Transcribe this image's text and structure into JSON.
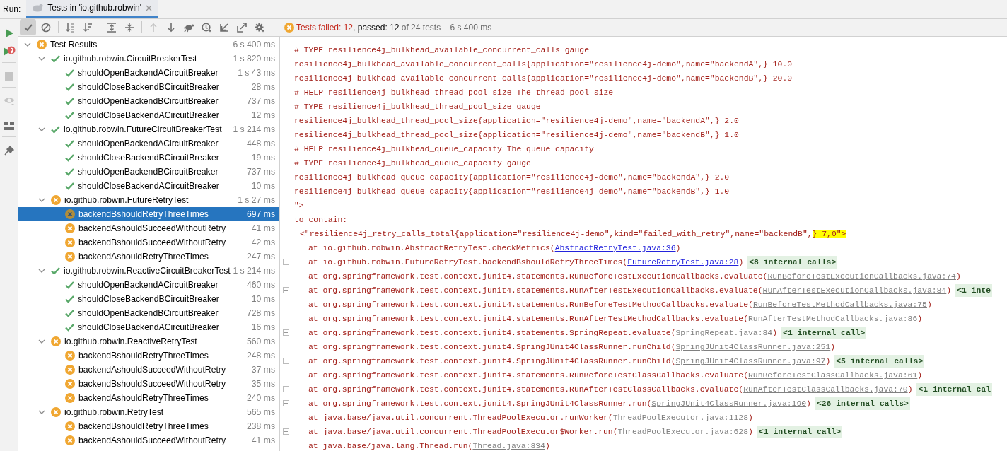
{
  "run_label": "Run:",
  "tabs": [
    {
      "label": "Tests in 'io.github.robwin'",
      "selected": true
    }
  ],
  "toolbar": {
    "toggles": [
      {
        "on": true
      },
      {
        "on": false
      }
    ],
    "navigation": [
      {
        "disabled": true
      },
      {
        "disabled": false
      }
    ]
  },
  "side_toolbar": {
    "stop_disabled": true
  },
  "status": {
    "failed": "Tests failed: 12",
    "passed": ", passed: 12",
    "total": " of 24 tests – 6 s 400 ms"
  },
  "tree": {
    "label": "Test Results",
    "failed": true,
    "time": "6 s 400 ms",
    "expanded": true,
    "children": [
      {
        "label": "io.github.robwin.CircuitBreakerTest",
        "failed": false,
        "time": "1 s 820 ms",
        "expanded": true,
        "children": [
          {
            "label": "shouldOpenBackendACircuitBreaker",
            "failed": false,
            "time": "1 s 43 ms",
            "selected": false
          },
          {
            "label": "shouldCloseBackendBCircuitBreaker",
            "failed": false,
            "time": "28 ms",
            "selected": false
          },
          {
            "label": "shouldOpenBackendBCircuitBreaker",
            "failed": false,
            "time": "737 ms",
            "selected": false
          },
          {
            "label": "shouldCloseBackendACircuitBreaker",
            "failed": false,
            "time": "12 ms",
            "selected": false
          }
        ]
      },
      {
        "label": "io.github.robwin.FutureCircuitBreakerTest",
        "failed": false,
        "time": "1 s 214 ms",
        "expanded": true,
        "children": [
          {
            "label": "shouldOpenBackendACircuitBreaker",
            "failed": false,
            "time": "448 ms",
            "selected": false
          },
          {
            "label": "shouldCloseBackendBCircuitBreaker",
            "failed": false,
            "time": "19 ms",
            "selected": false
          },
          {
            "label": "shouldOpenBackendBCircuitBreaker",
            "failed": false,
            "time": "737 ms",
            "selected": false
          },
          {
            "label": "shouldCloseBackendACircuitBreaker",
            "failed": false,
            "time": "10 ms",
            "selected": false
          }
        ]
      },
      {
        "label": "io.github.robwin.FutureRetryTest",
        "failed": true,
        "time": "1 s 27 ms",
        "expanded": true,
        "children": [
          {
            "label": "backendBshouldRetryThreeTimes",
            "failed": true,
            "time": "697 ms",
            "selected": true
          },
          {
            "label": "backendAshouldSucceedWithoutRetry",
            "failed": true,
            "time": "41 ms",
            "selected": false
          },
          {
            "label": "backendBshouldSucceedWithoutRetry",
            "failed": true,
            "time": "42 ms",
            "selected": false
          },
          {
            "label": "backendAshouldRetryThreeTimes",
            "failed": true,
            "time": "247 ms",
            "selected": false
          }
        ]
      },
      {
        "label": "io.github.robwin.ReactiveCircuitBreakerTest",
        "failed": false,
        "time": "1 s 214 ms",
        "expanded": true,
        "children": [
          {
            "label": "shouldOpenBackendACircuitBreaker",
            "failed": false,
            "time": "460 ms",
            "selected": false
          },
          {
            "label": "shouldCloseBackendBCircuitBreaker",
            "failed": false,
            "time": "10 ms",
            "selected": false
          },
          {
            "label": "shouldOpenBackendBCircuitBreaker",
            "failed": false,
            "time": "728 ms",
            "selected": false
          },
          {
            "label": "shouldCloseBackendACircuitBreaker",
            "failed": false,
            "time": "16 ms",
            "selected": false
          }
        ]
      },
      {
        "label": "io.github.robwin.ReactiveRetryTest",
        "failed": true,
        "time": "560 ms",
        "expanded": true,
        "children": [
          {
            "label": "backendBshouldRetryThreeTimes",
            "failed": true,
            "time": "248 ms",
            "selected": false
          },
          {
            "label": "backendAshouldSucceedWithoutRetry",
            "failed": true,
            "time": "37 ms",
            "selected": false
          },
          {
            "label": "backendBshouldSucceedWithoutRetry",
            "failed": true,
            "time": "35 ms",
            "selected": false
          },
          {
            "label": "backendAshouldRetryThreeTimes",
            "failed": true,
            "time": "240 ms",
            "selected": false
          }
        ]
      },
      {
        "label": "io.github.robwin.RetryTest",
        "failed": true,
        "time": "565 ms",
        "expanded": true,
        "children": [
          {
            "label": "backendBshouldRetryThreeTimes",
            "failed": true,
            "time": "238 ms",
            "selected": false
          },
          {
            "label": "backendAshouldSucceedWithoutRetry",
            "failed": true,
            "time": "41 ms",
            "selected": false
          }
        ]
      }
    ]
  },
  "console": [
    {
      "kind": "text",
      "text": "# TYPE resilience4j_bulkhead_available_concurrent_calls gauge"
    },
    {
      "kind": "text",
      "text": "resilience4j_bulkhead_available_concurrent_calls{application=\"resilience4j-demo\",name=\"backendA\",} 10.0"
    },
    {
      "kind": "text",
      "text": "resilience4j_bulkhead_available_concurrent_calls{application=\"resilience4j-demo\",name=\"backendB\",} 20.0"
    },
    {
      "kind": "text",
      "text": "# HELP resilience4j_bulkhead_thread_pool_size The thread pool size"
    },
    {
      "kind": "text",
      "text": "# TYPE resilience4j_bulkhead_thread_pool_size gauge"
    },
    {
      "kind": "text",
      "text": "resilience4j_bulkhead_thread_pool_size{application=\"resilience4j-demo\",name=\"backendA\",} 2.0"
    },
    {
      "kind": "text",
      "text": "resilience4j_bulkhead_thread_pool_size{application=\"resilience4j-demo\",name=\"backendB\",} 1.0"
    },
    {
      "kind": "text",
      "text": "# HELP resilience4j_bulkhead_queue_capacity The queue capacity"
    },
    {
      "kind": "text",
      "text": "# TYPE resilience4j_bulkhead_queue_capacity gauge"
    },
    {
      "kind": "text",
      "text": "resilience4j_bulkhead_queue_capacity{application=\"resilience4j-demo\",name=\"backendA\",} 2.0"
    },
    {
      "kind": "text",
      "text": "resilience4j_bulkhead_queue_capacity{application=\"resilience4j-demo\",name=\"backendB\",} 1.0"
    },
    {
      "kind": "text",
      "text": "\">"
    },
    {
      "kind": "text",
      "text": "to contain:"
    },
    {
      "kind": "expected",
      "text": "<\"resilience4j_retry_calls_total{application=\"resilience4j-demo\",kind=\"failed_with_retry\",name=\"backendB\",",
      "highlight": "} 7,0\">"
    },
    {
      "kind": "frame",
      "text": "at io.github.robwin.AbstractRetryTest.checkMetrics(",
      "link": "AbstractRetryTest.java:36",
      "close": ")",
      "own": true,
      "foldable": false
    },
    {
      "kind": "frame",
      "text": "at io.github.robwin.FutureRetryTest.backendBshouldRetryThreeTimes(",
      "link": "FutureRetryTest.java:28",
      "close": ")",
      "own": true,
      "foldable": true,
      "internal": "<8 internal calls>"
    },
    {
      "kind": "frame",
      "text": "at org.springframework.test.context.junit4.statements.RunBeforeTestExecutionCallbacks.evaluate(",
      "link": "RunBeforeTestExecutionCallbacks.java:74",
      "close": ")",
      "own": false,
      "foldable": false
    },
    {
      "kind": "frame",
      "text": "at org.springframework.test.context.junit4.statements.RunAfterTestExecutionCallbacks.evaluate(",
      "link": "RunAfterTestExecutionCallbacks.java:84",
      "close": ")",
      "own": false,
      "foldable": true,
      "internal": "<1 inte"
    },
    {
      "kind": "frame",
      "text": "at org.springframework.test.context.junit4.statements.RunBeforeTestMethodCallbacks.evaluate(",
      "link": "RunBeforeTestMethodCallbacks.java:75",
      "close": ")",
      "own": false,
      "foldable": false
    },
    {
      "kind": "frame",
      "text": "at org.springframework.test.context.junit4.statements.RunAfterTestMethodCallbacks.evaluate(",
      "link": "RunAfterTestMethodCallbacks.java:86",
      "close": ")",
      "own": false,
      "foldable": false
    },
    {
      "kind": "frame",
      "text": "at org.springframework.test.context.junit4.statements.SpringRepeat.evaluate(",
      "link": "SpringRepeat.java:84",
      "close": ")",
      "own": false,
      "foldable": true,
      "internal": "<1 internal call>"
    },
    {
      "kind": "frame",
      "text": "at org.springframework.test.context.junit4.SpringJUnit4ClassRunner.runChild(",
      "link": "SpringJUnit4ClassRunner.java:251",
      "close": ")",
      "own": false,
      "foldable": false
    },
    {
      "kind": "frame",
      "text": "at org.springframework.test.context.junit4.SpringJUnit4ClassRunner.runChild(",
      "link": "SpringJUnit4ClassRunner.java:97",
      "close": ")",
      "own": false,
      "foldable": true,
      "internal": "<5 internal calls>"
    },
    {
      "kind": "frame",
      "text": "at org.springframework.test.context.junit4.statements.RunBeforeTestClassCallbacks.evaluate(",
      "link": "RunBeforeTestClassCallbacks.java:61",
      "close": ")",
      "own": false,
      "foldable": false
    },
    {
      "kind": "frame",
      "text": "at org.springframework.test.context.junit4.statements.RunAfterTestClassCallbacks.evaluate(",
      "link": "RunAfterTestClassCallbacks.java:70",
      "close": ")",
      "own": false,
      "foldable": true,
      "internal": "<1 internal cal"
    },
    {
      "kind": "frame",
      "text": "at org.springframework.test.context.junit4.SpringJUnit4ClassRunner.run(",
      "link": "SpringJUnit4ClassRunner.java:190",
      "close": ")",
      "own": false,
      "foldable": true,
      "internal": "<26 internal calls>"
    },
    {
      "kind": "frame",
      "text": "at java.base/java.util.concurrent.ThreadPoolExecutor.runWorker(",
      "link": "ThreadPoolExecutor.java:1128",
      "close": ")",
      "own": false,
      "foldable": false
    },
    {
      "kind": "frame",
      "text": "at java.base/java.util.concurrent.ThreadPoolExecutor$Worker.run(",
      "link": "ThreadPoolExecutor.java:628",
      "close": ")",
      "own": false,
      "foldable": true,
      "internal": "<1 internal call>"
    },
    {
      "kind": "frame",
      "text": "at java.base/java.lang.Thread.run(",
      "link": "Thread.java:834",
      "close": ")",
      "own": false,
      "foldable": false
    }
  ]
}
